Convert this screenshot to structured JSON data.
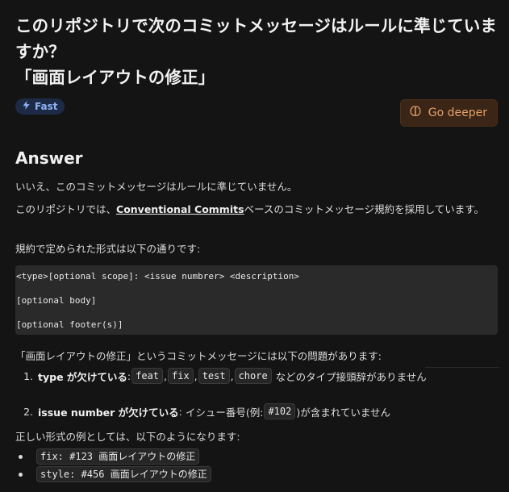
{
  "question": "このリポジトリで次のコミットメッセージはルールに準じていますか？\n「画面レイアウトの修正」",
  "badge": {
    "label": "Fast",
    "icon": "lightning-icon"
  },
  "go_deeper": {
    "label": "Go deeper",
    "icon": "brain-icon"
  },
  "answer": {
    "title": "Answer",
    "para1": "いいえ、このコミットメッセージはルールに準じていません。",
    "para2_pre": "このリポジトリでは、",
    "para2_link": "Conventional Commits",
    "para2_post": "ベースのコミットメッセージ規約を採用しています。",
    "para3": "規約で定められた形式は以下の通りです:",
    "code_lines": [
      "<type>[optional scope]: <issue numbrer> <description>",
      "[optional body]",
      "[optional footer(s)]"
    ],
    "para4": "「画面レイアウトの修正」というコミットメッセージには以下の問題があります:",
    "problems": [
      {
        "num": "1.",
        "term": "type が欠けている",
        "sep": ": ",
        "codes": [
          "feat",
          "fix",
          "test",
          "chore"
        ],
        "comma": ",",
        "tail": " などのタイプ接頭辞がありません"
      },
      {
        "num": "2.",
        "term": "issue number が欠けている",
        "sep": ": ",
        "pre": "イシュー番号(例: ",
        "code": "#102",
        "tail": ")が含まれていません"
      }
    ],
    "para5": "正しい形式の例としては、以下のようになります:",
    "examples": [
      "fix: #123 画面レイアウトの修正",
      "style: #456 画面レイアウトの修正"
    ]
  },
  "colors": {
    "background": "#141414",
    "accent_orange": "#e6a16a",
    "badge_blue": "#8fb2f5"
  }
}
